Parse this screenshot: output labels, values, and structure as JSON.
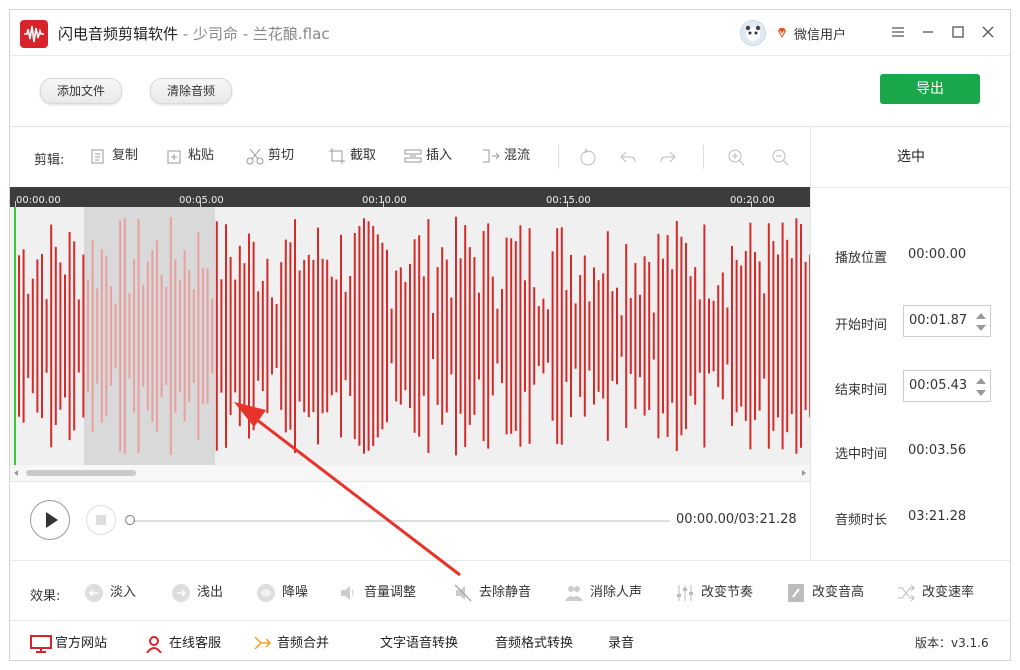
{
  "app": {
    "name": "闪电音频剪辑软件",
    "subtitle": " - 少司命 - 兰花酿.flac",
    "user_name": "微信用户",
    "accent": "#d8232a"
  },
  "toolbar": {
    "add_file": "添加文件",
    "clear_audio": "清除音频",
    "export": "导出"
  },
  "edit": {
    "label": "剪辑:",
    "tools": {
      "copy": "复制",
      "paste": "粘贴",
      "cut": "剪切",
      "crop": "截取",
      "insert": "插入",
      "mix": "混流"
    }
  },
  "ruler": {
    "ticks": [
      "00:00.00",
      "00:05.00",
      "00:10.00",
      "00:15.00",
      "00:20.00"
    ]
  },
  "selection_panel": {
    "title": "选中",
    "play_position_label": "播放位置",
    "play_position": "00:00.00",
    "start_label": "开始时间",
    "start": "00:01.87",
    "end_label": "结束时间",
    "end": "00:05.43",
    "selected_label": "选中时间",
    "selected": "00:03.56",
    "duration_label": "音频时长",
    "duration": "03:21.28"
  },
  "player": {
    "time": "00:00.00/03:21.28",
    "progress": 0
  },
  "effects": {
    "label": "效果:",
    "fade_in": "淡入",
    "fade_out": "浅出",
    "denoise": "降噪",
    "volume": "音量调整",
    "remove_silence": "去除静音",
    "remove_vocal": "消除人声",
    "tempo": "改变节奏",
    "pitch": "改变音高",
    "speed": "改变速率"
  },
  "footer": {
    "website": "官方网站",
    "support": "在线客服",
    "merge": "音频合并",
    "tts": "文字语音转换",
    "convert": "音频格式转换",
    "record": "录音",
    "version": "版本：v3.1.6"
  },
  "colors": {
    "wave": "#d42a2a",
    "wave_selected": "#e8a0a0",
    "export_button": "#1aa84a"
  }
}
